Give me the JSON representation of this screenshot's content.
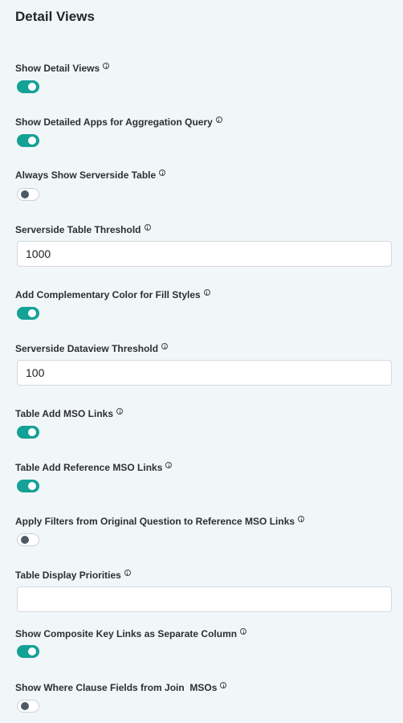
{
  "section": {
    "title": "Detail Views"
  },
  "settings": [
    {
      "label": "Show Detail Views",
      "type": "toggle",
      "value": true
    },
    {
      "label": "Show Detailed Apps for Aggregation Query",
      "type": "toggle",
      "value": true
    },
    {
      "label": "Always Show Serverside Table",
      "type": "toggle",
      "value": false
    },
    {
      "label": "Serverside Table Threshold",
      "type": "input",
      "value": "1000"
    },
    {
      "label": "Add Complementary Color for Fill Styles",
      "type": "toggle",
      "value": true
    },
    {
      "label": "Serverside Dataview Threshold",
      "type": "input",
      "value": "100"
    },
    {
      "label": "Table Add MSO Links",
      "type": "toggle",
      "value": true
    },
    {
      "label": "Table Add Reference MSO Links",
      "type": "toggle",
      "value": true
    },
    {
      "label": "Apply Filters from Original Question to Reference MSO Links",
      "type": "toggle",
      "value": false
    },
    {
      "label": "Table Display Priorities",
      "type": "input",
      "value": ""
    },
    {
      "label": "Show Composite Key Links as Separate Column",
      "type": "toggle",
      "value": true
    },
    {
      "label": "Show Where Clause Fields from Join  MSOs",
      "type": "toggle",
      "value": false
    }
  ],
  "colors": {
    "toggle_on": "#14a196",
    "background": "#f1f6f9"
  },
  "icons": {
    "info": "info-circle-icon"
  }
}
